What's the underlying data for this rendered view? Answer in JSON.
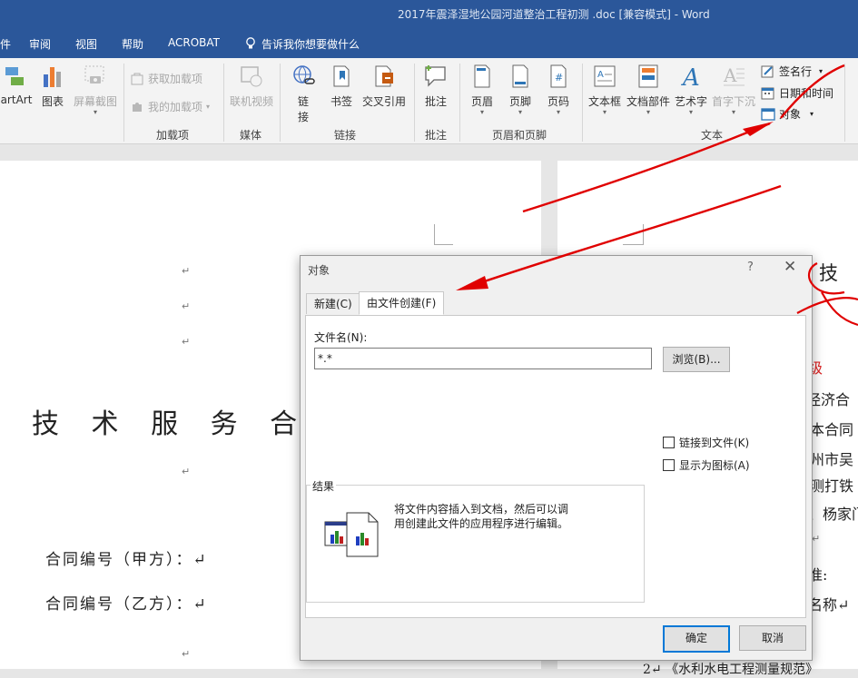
{
  "window": {
    "title": "2017年震泽湿地公园河道整治工程初测 .doc [兼容模式] - Word"
  },
  "menu": {
    "items": [
      "件",
      "审阅",
      "视图",
      "帮助",
      "ACROBAT"
    ],
    "tell_me": "告诉我你想要做什么"
  },
  "ribbon": {
    "smartart": "artArt",
    "chart": "图表",
    "screenshot": "屏幕截图",
    "get_addins": "获取加载项",
    "my_addins": "我的加载项",
    "group_addins": "加载项",
    "online_video": "联机视频",
    "group_media": "媒体",
    "link_line1": "链",
    "link_line2": "接",
    "bookmark": "书签",
    "cross_ref": "交叉引用",
    "group_links": "链接",
    "comment": "批注",
    "group_comments": "批注",
    "header": "页眉",
    "footer": "页脚",
    "page_number": "页码",
    "group_header_footer": "页眉和页脚",
    "text_box": "文本框",
    "quick_parts": "文档部件",
    "word_art": "艺术字",
    "drop_cap": "首字下沉",
    "signature_line": "签名行",
    "date_time": "日期和时间",
    "object": "对象",
    "group_text": "文本"
  },
  "document": {
    "pilcrow": "↵",
    "title": "技 术 服 务 合 同 书",
    "line_a": "合同编号（甲方）：↵",
    "line_b": "合同编号（乙方）：↵",
    "right_title": "技 术",
    "right_lines": [
      "级",
      "国经济合",
      "订本合同",
      "苏州市吴",
      "实测打铁",
      "、杨家门",
      "↵",
      "准:",
      "名称↵",
      "2↵ 《水利水电工程测量规范》"
    ]
  },
  "dialog": {
    "title": "对象",
    "help": "?",
    "close": "✕",
    "tab_new": "新建(C)",
    "tab_from_file": "由文件创建(F)",
    "filename_label": "文件名(N):",
    "filename_value": "*.*",
    "browse": "浏览(B)...",
    "link_to_file": "链接到文件(K)",
    "display_as_icon": "显示为图标(A)",
    "result_label": "结果",
    "result_text_1": "将文件内容插入到文档，然后可以调",
    "result_text_2": "用创建此文件的应用程序进行编辑。",
    "ok": "确定",
    "cancel": "取消"
  },
  "colors": {
    "title_bar": "#2b579a",
    "annotation": "#e00000",
    "primary_border": "#0078d7"
  }
}
